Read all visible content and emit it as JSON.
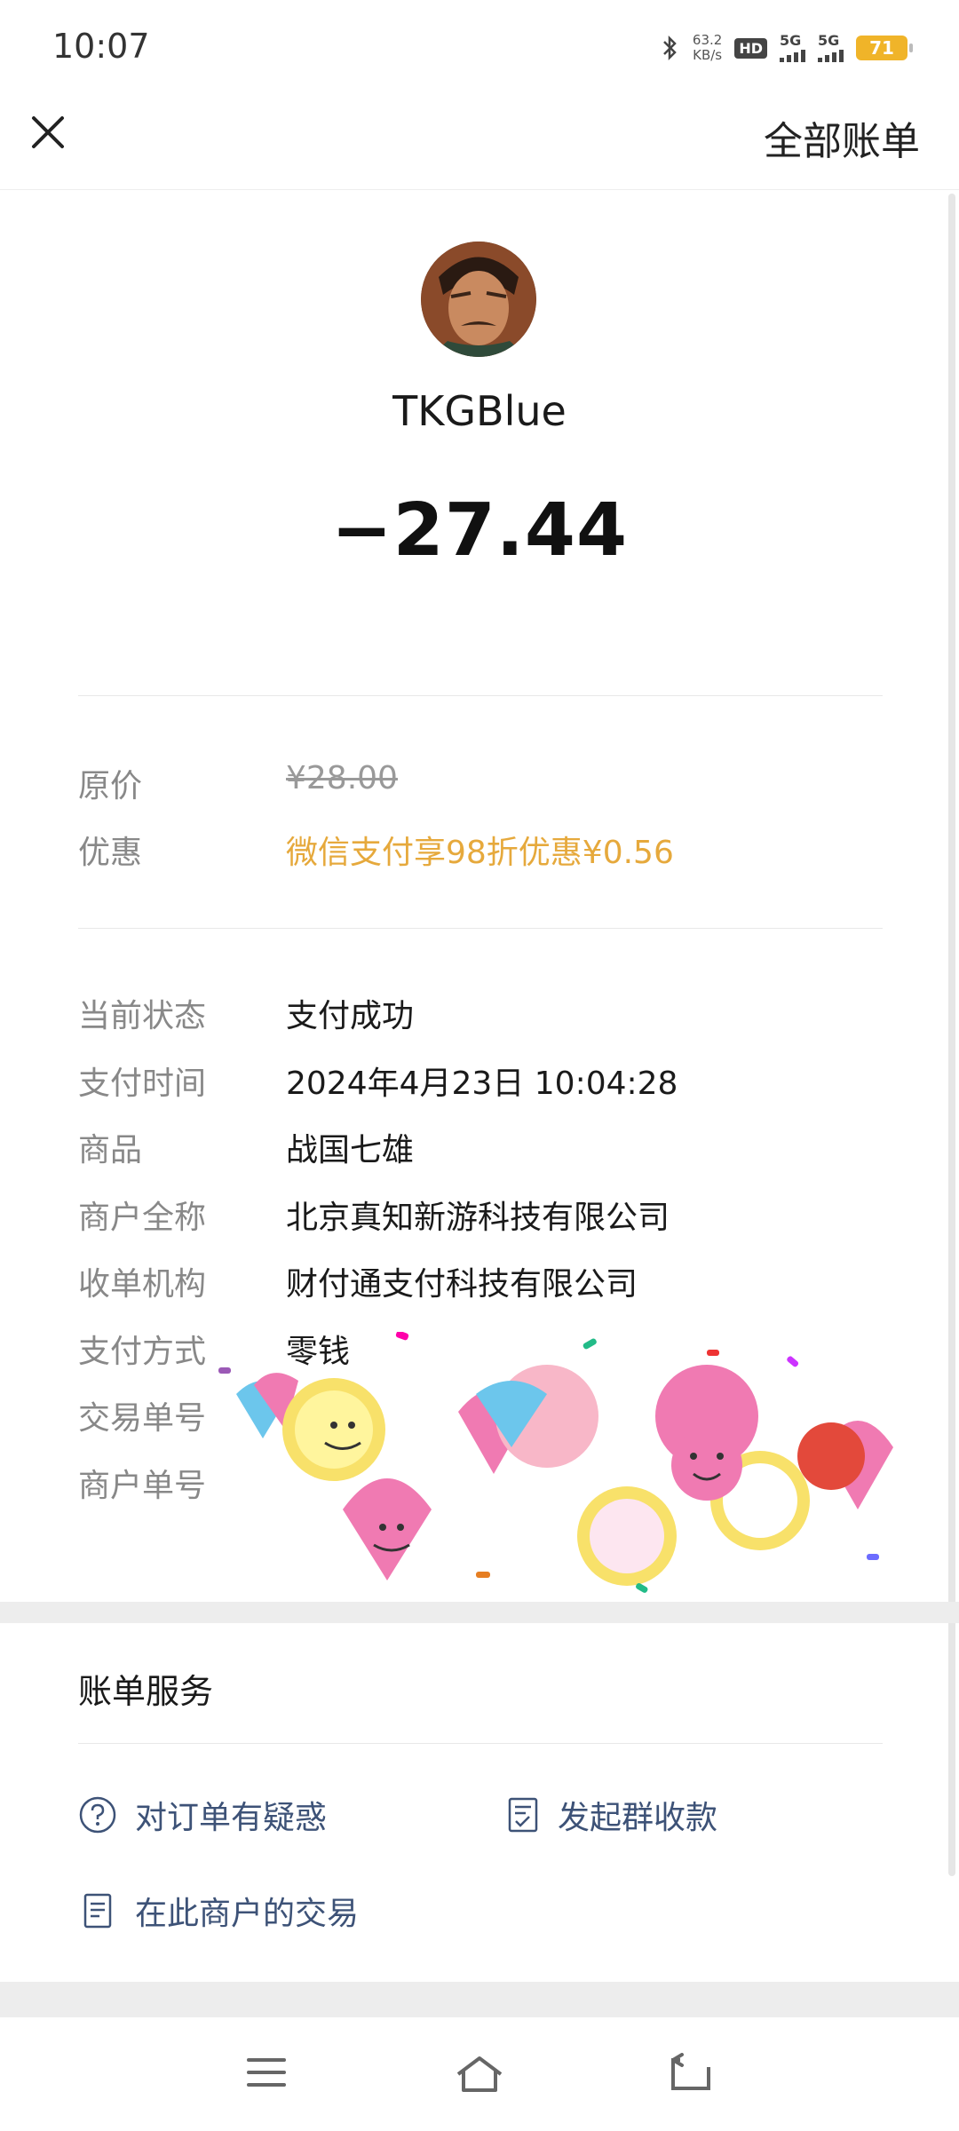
{
  "status_bar": {
    "time": "10:07",
    "speed_value": "63.2",
    "speed_unit": "KB/s",
    "hd_label": "HD",
    "net1": "5G",
    "net2": "5G",
    "battery": "71"
  },
  "nav": {
    "all_bills": "全部账单"
  },
  "header": {
    "payee": "TKGBlue",
    "amount": "−27.44"
  },
  "pricing": {
    "original_label": "原价",
    "original_value": "¥28.00",
    "discount_label": "优惠",
    "discount_value": "微信支付享98折优惠¥0.56"
  },
  "details": [
    {
      "label": "当前状态",
      "value": "支付成功"
    },
    {
      "label": "支付时间",
      "value": "2024年4月23日 10:04:28"
    },
    {
      "label": "商品",
      "value": "战国七雄"
    },
    {
      "label": "商户全称",
      "value": "北京真知新游科技有限公司"
    },
    {
      "label": "收单机构",
      "value": "财付通支付科技有限公司"
    },
    {
      "label": "支付方式",
      "value": "零钱"
    },
    {
      "label": "交易单号",
      "value": ""
    },
    {
      "label": "商户单号",
      "value": ""
    }
  ],
  "services": {
    "title": "账单服务",
    "question": "对订单有疑惑",
    "group_pay": "发起群收款",
    "merchant_tx": "在此商户的交易"
  },
  "colors": {
    "discount": "#e6a93c",
    "link": "#3d5277",
    "label": "#888888"
  },
  "icons": [
    "close-icon",
    "question-circle-icon",
    "group-receipt-icon",
    "document-icon",
    "menu-icon",
    "home-icon",
    "back-icon"
  ]
}
